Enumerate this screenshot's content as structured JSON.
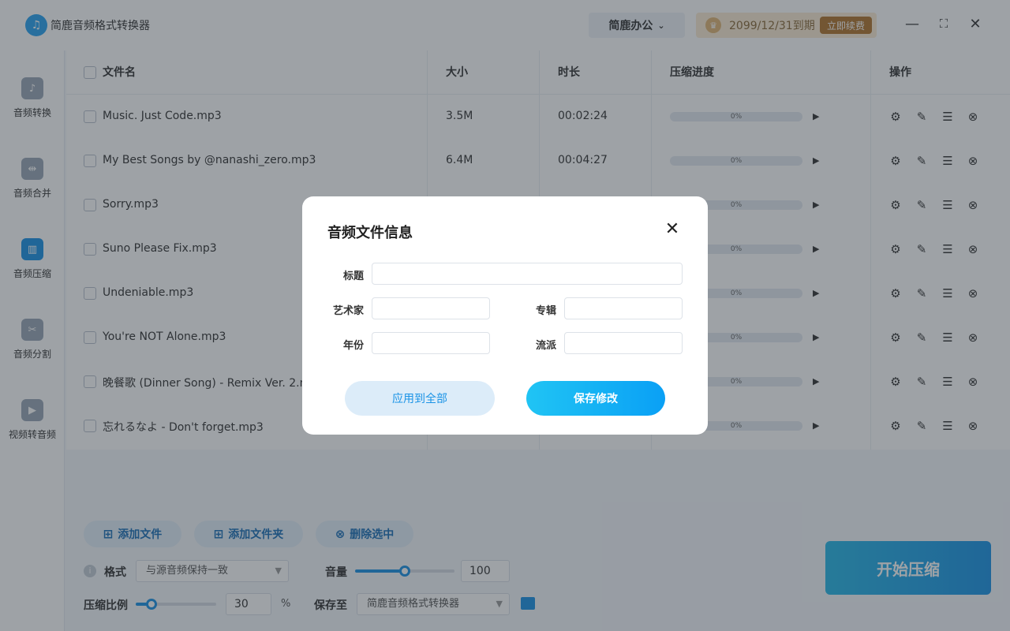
{
  "app": {
    "title": "简鹿音频格式转换器",
    "office_label": "简鹿办公",
    "vip_date": "2099/12/31到期",
    "renew_label": "立即续费"
  },
  "sidebar": {
    "items": [
      {
        "label": "音频转换",
        "icon": "music-note-icon",
        "active": false
      },
      {
        "label": "音频合并",
        "icon": "waveform-merge-icon",
        "active": false
      },
      {
        "label": "音频压缩",
        "icon": "compress-icon",
        "active": true
      },
      {
        "label": "音频分割",
        "icon": "scissors-icon",
        "active": false
      },
      {
        "label": "视频转音频",
        "icon": "video-icon",
        "active": false
      }
    ]
  },
  "table": {
    "headers": {
      "name": "文件名",
      "size": "大小",
      "duration": "时长",
      "progress": "压缩进度",
      "actions": "操作"
    },
    "rows": [
      {
        "name": "Music. Just Code.mp3",
        "size": "3.5M",
        "duration": "00:02:24",
        "progress": "0%"
      },
      {
        "name": "My Best Songs by @nanashi_zero.mp3",
        "size": "6.4M",
        "duration": "00:04:27",
        "progress": "0%"
      },
      {
        "name": "Sorry.mp3",
        "size": "",
        "duration": "",
        "progress": "0%"
      },
      {
        "name": "Suno Please Fix.mp3",
        "size": "",
        "duration": "",
        "progress": "0%"
      },
      {
        "name": "Undeniable.mp3",
        "size": "",
        "duration": "",
        "progress": "0%"
      },
      {
        "name": "You're NOT Alone.mp3",
        "size": "",
        "duration": "",
        "progress": "0%"
      },
      {
        "name": "晚餐歌 (Dinner Song) - Remix Ver. 2.mp3",
        "size": "",
        "duration": "",
        "progress": "0%"
      },
      {
        "name": "忘れるなよ - Don't forget.mp3",
        "size": "",
        "duration": "",
        "progress": "0%"
      }
    ]
  },
  "toolbar": {
    "add_file": "添加文件",
    "add_folder": "添加文件夹",
    "delete_selected": "删除选中"
  },
  "settings": {
    "format_label": "格式",
    "format_value": "与源音频保持一致",
    "volume_label": "音量",
    "volume_value": "100",
    "volume_fraction": 0.5,
    "ratio_label": "压缩比例",
    "ratio_value": "30",
    "ratio_unit": "%",
    "ratio_fraction": 0.2,
    "save_to_label": "保存至",
    "save_to_value": "简鹿音频格式转换器"
  },
  "start_label": "开始压缩",
  "modal": {
    "title": "音频文件信息",
    "fields": {
      "title_label": "标题",
      "artist_label": "艺术家",
      "album_label": "专辑",
      "year_label": "年份",
      "genre_label": "流派"
    },
    "apply_all_label": "应用到全部",
    "save_label": "保存修改"
  },
  "colors": {
    "accent": "#1a93e6",
    "vip_bg": "#fbecd4",
    "renew_bg": "#b1762e"
  }
}
